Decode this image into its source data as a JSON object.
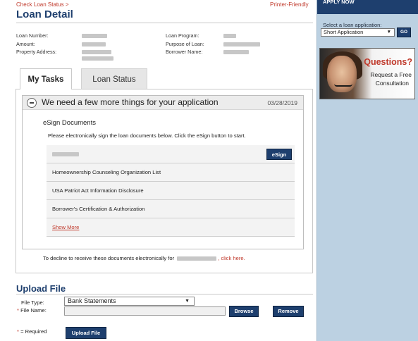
{
  "breadcrumb": {
    "link": "Check Loan Status",
    "separator": ">"
  },
  "printer_friendly": "Printer-Friendly",
  "page_title": "Loan Detail",
  "loan_info": {
    "left_labels": [
      "Loan Number:",
      "Amount:",
      "Property Address:"
    ],
    "right_labels": [
      "Loan Program:",
      "Purpose of Loan:",
      "Borrower Name:"
    ]
  },
  "tabs": [
    {
      "label": "My Tasks",
      "active": true
    },
    {
      "label": "Loan Status",
      "active": false
    }
  ],
  "task": {
    "title": "We need a few more things for your application",
    "date": "03/28/2019",
    "section_title": "eSign Documents",
    "instructions": "Please electronically sign the loan documents below. Click the eSign button to start.",
    "esign_label": "eSign",
    "documents": [
      "Homeownership Counseling Organization List",
      "USA Patriot Act Information Disclosure",
      "Borrower's Certification & Authorization"
    ],
    "show_more": "Show More",
    "decline_text": "To decline to receive these documents electronically for",
    "decline_link": ", click here."
  },
  "upload": {
    "title": "Upload File",
    "file_type_label": "File Type:",
    "file_type_value": "Bank Statements",
    "file_name_label": "File Name:",
    "browse_label": "Browse",
    "remove_label": "Remove",
    "required_note": "= Required",
    "upload_button": "Upload File"
  },
  "sidebar": {
    "header": "APPLY NOW",
    "select_label": "Select a loan application:",
    "selected_application": "Short Application",
    "go_label": "GO",
    "promo": {
      "headline": "Questions?",
      "line1": "Request a Free",
      "line2": "Consultation"
    }
  },
  "colors": {
    "brand_navy": "#1e3f6e",
    "link_red": "#c0392b",
    "sidebar_blue": "#bcd1e2"
  }
}
